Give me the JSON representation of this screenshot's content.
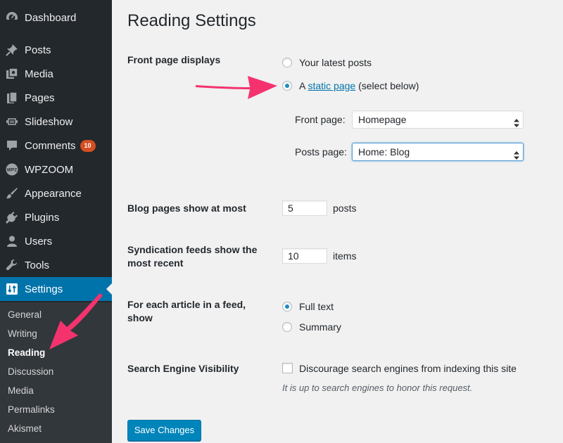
{
  "sidebar": {
    "items": [
      {
        "label": "Dashboard",
        "icon": "dashboard-icon"
      },
      {
        "label": "Posts",
        "icon": "pin-icon"
      },
      {
        "label": "Media",
        "icon": "media-icon"
      },
      {
        "label": "Pages",
        "icon": "pages-icon"
      },
      {
        "label": "Slideshow",
        "icon": "slideshow-icon"
      },
      {
        "label": "Comments",
        "icon": "comment-icon",
        "badge": "10"
      },
      {
        "label": "WPZOOM",
        "icon": "wpzoom-logo-icon",
        "icon_text": "WPZ"
      },
      {
        "label": "Appearance",
        "icon": "brush-icon"
      },
      {
        "label": "Plugins",
        "icon": "plug-icon"
      },
      {
        "label": "Users",
        "icon": "user-icon"
      },
      {
        "label": "Tools",
        "icon": "wrench-icon"
      },
      {
        "label": "Settings",
        "icon": "settings-icon",
        "active": true
      }
    ],
    "submenu": [
      "General",
      "Writing",
      "Reading",
      "Discussion",
      "Media",
      "Permalinks",
      "Akismet"
    ],
    "submenu_current": "Reading"
  },
  "page": {
    "title": "Reading Settings",
    "front_page_displays": {
      "label": "Front page displays",
      "option_latest": "Your latest posts",
      "option_static_prefix": "A",
      "option_static_link": "static page",
      "option_static_suffix": "(select below)",
      "selected": "static",
      "front_page_label": "Front page:",
      "front_page_value": "Homepage",
      "posts_page_label": "Posts page:",
      "posts_page_value": "Home: Blog"
    },
    "blog_pages": {
      "label": "Blog pages show at most",
      "value": "5",
      "unit": "posts"
    },
    "syndication": {
      "label": "Syndication feeds show the most recent",
      "value": "10",
      "unit": "items"
    },
    "feed_article": {
      "label": "For each article in a feed, show",
      "option_full": "Full text",
      "option_summary": "Summary",
      "selected": "full"
    },
    "search_visibility": {
      "label": "Search Engine Visibility",
      "checkbox_label": "Discourage search engines from indexing this site",
      "checked": false,
      "hint": "It is up to search engines to honor this request."
    },
    "save_button": "Save Changes"
  },
  "colors": {
    "sidebar_bg": "#23282d",
    "submenu_bg": "#32373c",
    "accent": "#0073aa",
    "badge": "#d54e21",
    "annotation_arrow": "#f4336e",
    "page_bg": "#f1f1f1"
  }
}
